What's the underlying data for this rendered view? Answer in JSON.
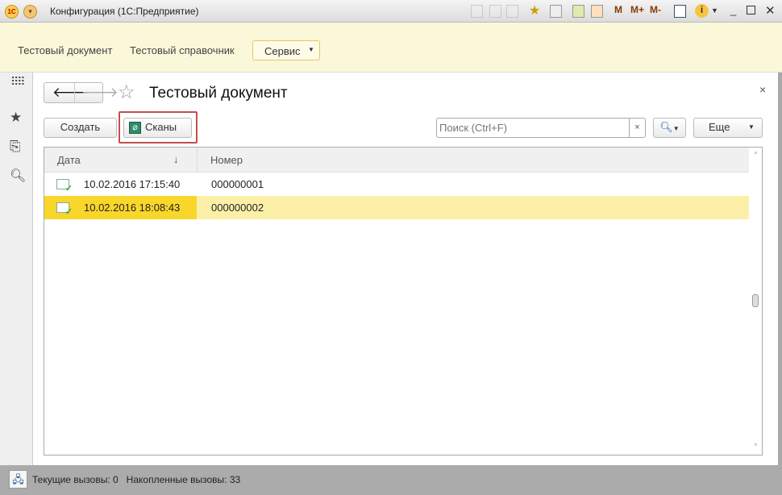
{
  "window": {
    "title": "Конфигурация  (1С:Предприятие)",
    "toolbar": [
      "M",
      "M+",
      "M-"
    ],
    "logo": "1C"
  },
  "menu": {
    "items": [
      "Тестовый документ",
      "Тестовый справочник"
    ],
    "service": "Сервис"
  },
  "form": {
    "title": "Тестовый документ",
    "close": "×",
    "create": "Создать",
    "scans": "Сканы",
    "search_placeholder": "Поиск (Ctrl+F)",
    "search_clear": "×",
    "more": "Еще"
  },
  "table": {
    "columns": [
      "Дата",
      "Номер"
    ],
    "sort_indicator": "↓",
    "rows": [
      {
        "date": "10.02.2016 17:15:40",
        "number": "000000001"
      },
      {
        "date": "10.02.2016 18:08:43",
        "number": "000000002",
        "selected": true
      }
    ]
  },
  "status": {
    "text": "Текущие вызовы: 0   Накопленные вызовы: 33"
  },
  "colors": {
    "menu_bg": "#fbf7d9",
    "selection": "#f9d62a",
    "selection_light": "#fcf0a8",
    "highlight_frame": "#c0504d"
  }
}
